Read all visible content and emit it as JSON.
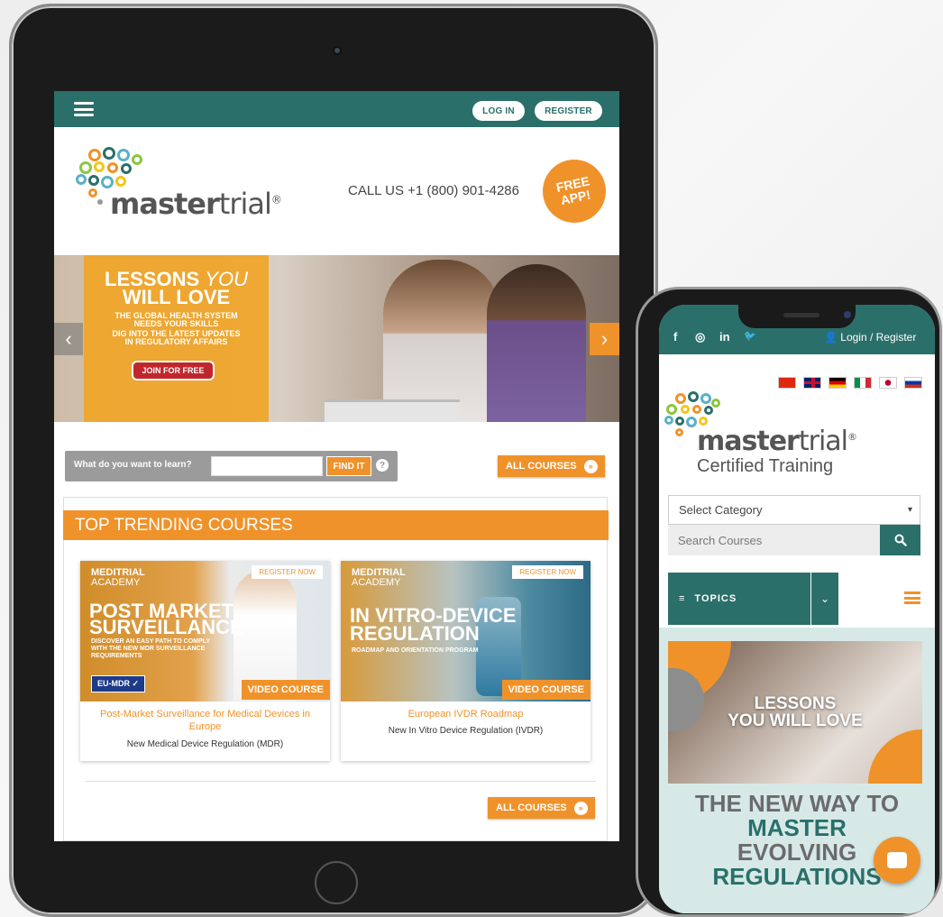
{
  "colors": {
    "teal": "#2a6f6a",
    "orange": "#f0922a",
    "gray_bar": "#9b9b9b"
  },
  "tablet": {
    "nav": {
      "menu_icon": "hamburger-icon",
      "login": "LOG IN",
      "register": "REGISTER"
    },
    "logo": {
      "word_a": "master",
      "word_b": "trial",
      "reg": "®"
    },
    "call_us": "CALL US +1 (800) 901-4286",
    "free_app": {
      "line1": "FREE",
      "line2": "APP!"
    },
    "hero": {
      "title_line1_a": "LESSONS ",
      "title_line1_b": "YOU",
      "title_line2": "WILL LOVE",
      "sub1": "THE GLOBAL HEALTH SYSTEM",
      "sub2": "NEEDS YOUR SKILLS",
      "sub3": "DIG INTO THE LATEST UPDATES",
      "sub4": "IN REGULATORY AFFAIRS",
      "cta": "JOIN FOR FREE",
      "prev": "‹",
      "next": "›"
    },
    "search": {
      "label": "What do you want to learn?",
      "value": "",
      "button": "FIND IT",
      "help": "?"
    },
    "all_courses": "ALL COURSES",
    "trending_title": "TOP TRENDING COURSES",
    "courses": [
      {
        "brand_a": "MEDITRIAL",
        "brand_b": "ACADEMY",
        "banner_line1": "POST MARKET",
        "banner_line2": "SURVEILLANCE",
        "banner_sub1": "DISCOVER AN EASY PATH TO COMPLY",
        "banner_sub2": "WITH THE NEW MDR SURVEILLANCE",
        "banner_sub3": "REQUIREMENTS",
        "register": "REGISTER NOW",
        "video": "VIDEO COURSE",
        "tag": "EU-MDR ✓",
        "title_line1": "Post-Market Surveillance for Medical Devices in",
        "title_line2": "Europe",
        "subtitle": "New Medical Device Regulation (MDR)"
      },
      {
        "brand_a": "MEDITRIAL",
        "brand_b": "ACADEMY",
        "banner_line1": "IN VITRO-DEVICE",
        "banner_line2": "REGULATION",
        "banner_sub1": "ROADMAP AND ORIENTATION PROGRAM",
        "register": "REGISTER NOW",
        "video": "VIDEO COURSE",
        "title_line1": "European IVDR Roadmap",
        "subtitle": "New In Vitro Device Regulation (IVDR)"
      }
    ]
  },
  "phone": {
    "social": [
      "f",
      "◎",
      "in",
      "🐦"
    ],
    "login": "Login / Register",
    "flags": [
      "cn-flag",
      "uk-flag",
      "de-flag",
      "it-flag",
      "jp-flag",
      "ru-flag"
    ],
    "logo": {
      "word_a": "master",
      "word_b": "trial",
      "reg": "®",
      "tagline": "Certified Training"
    },
    "category_select": "Select Category",
    "search_placeholder": "Search Courses",
    "topics": "TOPICS",
    "promo": {
      "line1": "LESSONS",
      "line2": "YOU WILL LOVE"
    },
    "headline": {
      "l1": "THE NEW WAY TO",
      "l2": "MASTER",
      "l3": "EVOLVING",
      "l4": "REGULATIONS"
    }
  }
}
